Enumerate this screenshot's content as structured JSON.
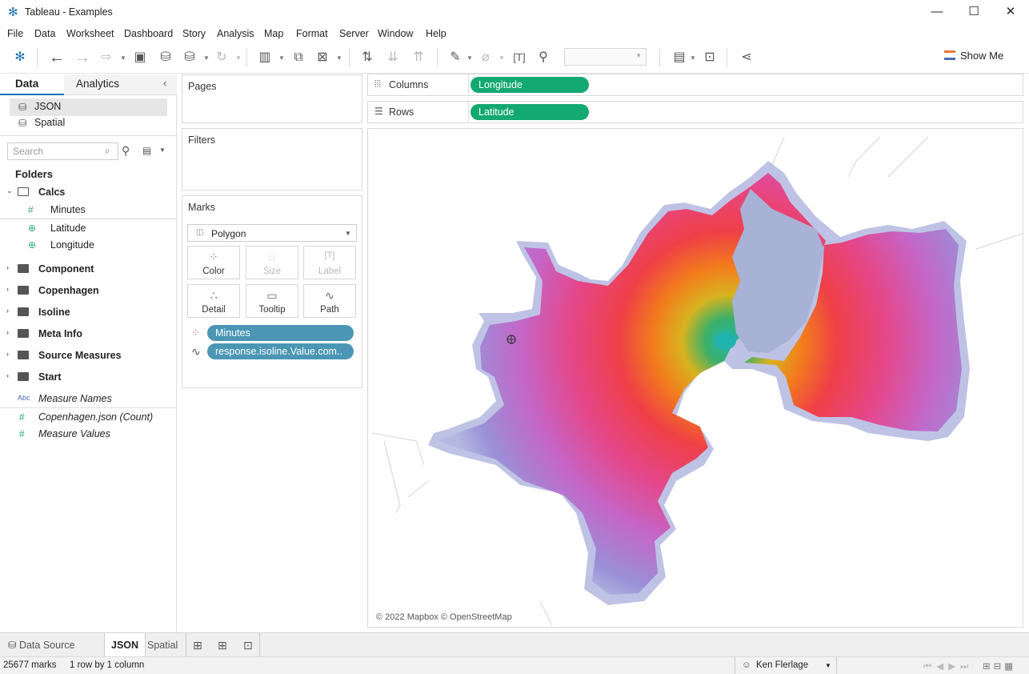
{
  "window": {
    "title": "Tableau - Examples",
    "minimize": "—",
    "maximize": "☐",
    "close": "✕"
  },
  "menu": [
    "File",
    "Data",
    "Worksheet",
    "Dashboard",
    "Story",
    "Analysis",
    "Map",
    "Format",
    "Server",
    "Window",
    "Help"
  ],
  "toolbar": {
    "show_me": "Show Me"
  },
  "data_pane": {
    "tabs": [
      "Data",
      "Analytics"
    ],
    "sources": [
      "JSON",
      "Spatial"
    ],
    "search_placeholder": "Search",
    "folders_heading": "Folders",
    "calcs": {
      "label": "Calcs",
      "fields": [
        "Minutes",
        "Latitude",
        "Longitude"
      ]
    },
    "folders": [
      "Component",
      "Copenhagen",
      "Isoline",
      "Meta Info",
      "Source Measures",
      "Start"
    ],
    "extra_fields": [
      "Measure Names",
      "Copenhagen.json (Count)",
      "Measure Values"
    ]
  },
  "cards": {
    "pages": "Pages",
    "filters": "Filters",
    "marks": "Marks",
    "mark_type": "Polygon",
    "buttons": [
      "Color",
      "Size",
      "Label",
      "Detail",
      "Tooltip",
      "Path"
    ],
    "pills": [
      "Minutes",
      "response.isoline.Value.com.."
    ]
  },
  "shelves": {
    "columns_label": "Columns",
    "columns_pill": "Longitude",
    "rows_label": "Rows",
    "rows_pill": "Latitude"
  },
  "viz": {
    "attribution": "© 2022 Mapbox © OpenStreetMap"
  },
  "sheet_tabs": {
    "data_source": "Data Source",
    "tabs": [
      "JSON",
      "Spatial"
    ]
  },
  "status": {
    "marks": "25677 marks",
    "dims": "1 row by 1 column",
    "user": "Ken Flerlage"
  },
  "colors": {
    "pill_green": "#14a873",
    "pill_blue": "#4a96b4",
    "water": "#a7b2d6"
  }
}
